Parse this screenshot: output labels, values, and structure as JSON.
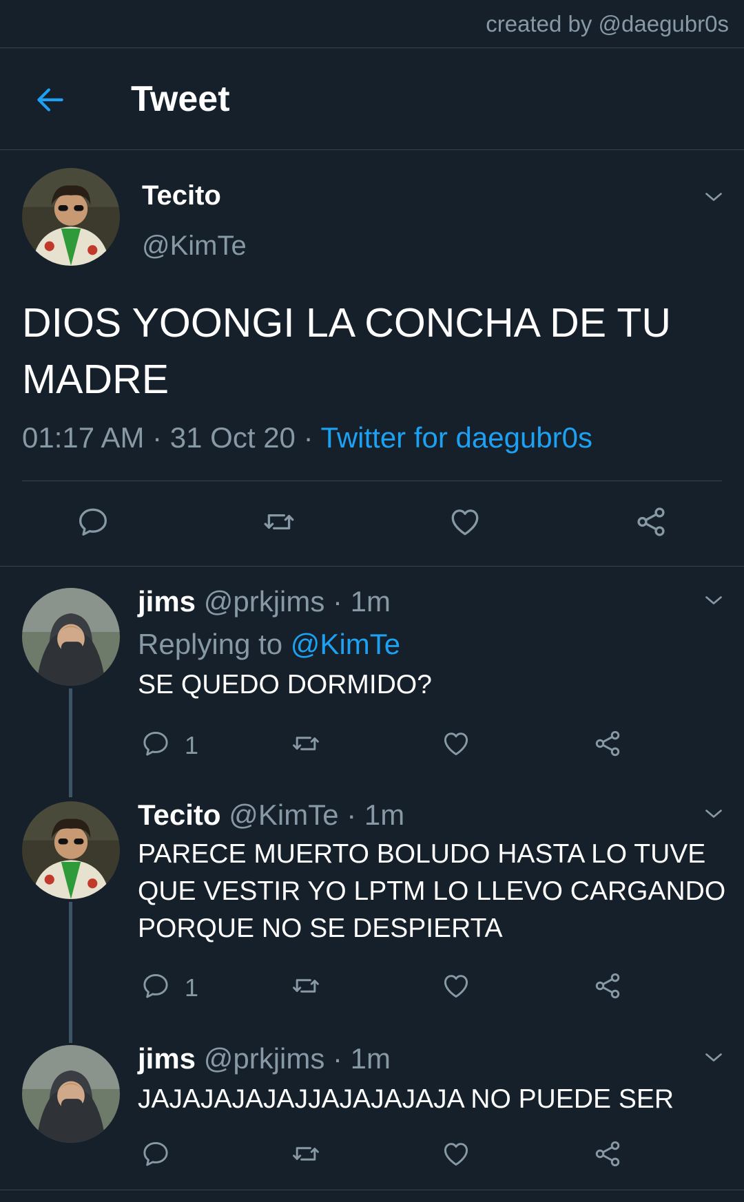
{
  "watermark": "created by @daegubr0s",
  "header": {
    "title": "Tweet",
    "back_icon": "arrow-left-icon"
  },
  "colors": {
    "background": "#15202b",
    "accent": "#1da1f2",
    "muted": "#8899a6",
    "border": "#38444d"
  },
  "main_tweet": {
    "name": "Tecito",
    "handle": "@KimTe",
    "text": "DIOS YOONGI LA CONCHA DE TU MADRE",
    "time": "01:17 AM",
    "sep1": " · ",
    "date": "31 Oct 20",
    "sep2": " · ",
    "source": "Twitter for daegubr0s"
  },
  "replies": [
    {
      "name": "jims",
      "handle": "@prkjims",
      "age": " · 1m",
      "replying_label": "Replying to ",
      "replying_to": "@KimTe",
      "text": "SE QUEDO DORMIDO?",
      "reply_count": "1"
    },
    {
      "name": "Tecito",
      "handle": "@KimTe",
      "age": " · 1m",
      "text": "PARECE MUERTO BOLUDO HASTA LO TUVE QUE VESTIR YO LPTM LO LLEVO CARGANDO PORQUE NO SE DESPIERTA",
      "reply_count": "1"
    },
    {
      "name": "jims",
      "handle": "@prkjims",
      "age": " · 1m",
      "text": "JAJAJAJAJAJJAJAJAJAJA NO PUEDE SER",
      "reply_count": ""
    }
  ]
}
